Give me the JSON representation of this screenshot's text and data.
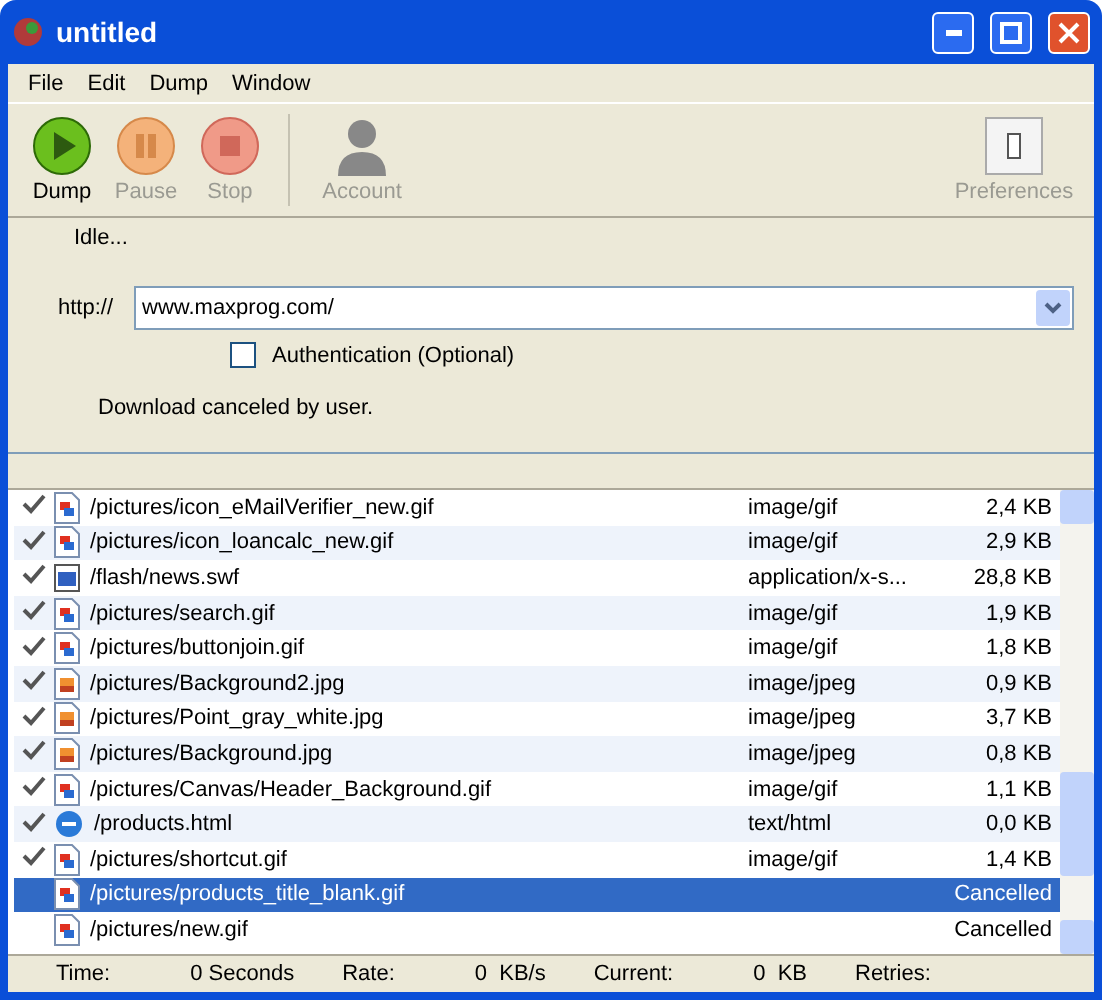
{
  "window": {
    "title": "untitled"
  },
  "menu": [
    "File",
    "Edit",
    "Dump",
    "Window"
  ],
  "toolbar": [
    {
      "label": "Dump",
      "kind": "play",
      "disabled": false
    },
    {
      "label": "Pause",
      "kind": "pause",
      "disabled": true
    },
    {
      "label": "Stop",
      "kind": "stop",
      "disabled": true
    },
    {
      "label": "Account",
      "kind": "account",
      "disabled": true
    },
    {
      "label": "Preferences",
      "kind": "prefs",
      "disabled": true
    }
  ],
  "status": "Idle...",
  "url": {
    "prefix": "http://",
    "value": "www.maxprog.com/"
  },
  "auth": {
    "label": "Authentication (Optional)",
    "checked": false
  },
  "message": "Download canceled by user.",
  "files": [
    {
      "path": "/pictures/icon_eMailVerifier_new.gif",
      "type": "image/gif",
      "size": "2,4 KB",
      "kind": "gif",
      "checked": true,
      "selected": false
    },
    {
      "path": "/pictures/icon_loancalc_new.gif",
      "type": "image/gif",
      "size": "2,9 KB",
      "kind": "gif",
      "checked": true,
      "selected": false
    },
    {
      "path": "/flash/news.swf",
      "type": "application/x-s...",
      "size": "28,8 KB",
      "kind": "swf",
      "checked": true,
      "selected": false
    },
    {
      "path": "/pictures/search.gif",
      "type": "image/gif",
      "size": "1,9 KB",
      "kind": "gif",
      "checked": true,
      "selected": false
    },
    {
      "path": "/pictures/buttonjoin.gif",
      "type": "image/gif",
      "size": "1,8 KB",
      "kind": "gif",
      "checked": true,
      "selected": false
    },
    {
      "path": "/pictures/Background2.jpg",
      "type": "image/jpeg",
      "size": "0,9 KB",
      "kind": "jpg",
      "checked": true,
      "selected": false
    },
    {
      "path": "/pictures/Point_gray_white.jpg",
      "type": "image/jpeg",
      "size": "3,7 KB",
      "kind": "jpg",
      "checked": true,
      "selected": false
    },
    {
      "path": "/pictures/Background.jpg",
      "type": "image/jpeg",
      "size": "0,8 KB",
      "kind": "jpg",
      "checked": true,
      "selected": false
    },
    {
      "path": "/pictures/Canvas/Header_Background.gif",
      "type": "image/gif",
      "size": "1,1 KB",
      "kind": "gif",
      "checked": true,
      "selected": false
    },
    {
      "path": "/products.html",
      "type": "text/html",
      "size": "0,0 KB",
      "kind": "html",
      "checked": true,
      "selected": false
    },
    {
      "path": "/pictures/shortcut.gif",
      "type": "image/gif",
      "size": "1,4 KB",
      "kind": "gif",
      "checked": true,
      "selected": false
    },
    {
      "path": "/pictures/products_title_blank.gif",
      "size": "Cancelled",
      "kind": "gif",
      "checked": false,
      "selected": true
    },
    {
      "path": "/pictures/new.gif",
      "size": "Cancelled",
      "kind": "gif",
      "checked": false,
      "selected": false
    }
  ],
  "status_bar": [
    {
      "label": "Time:",
      "value": "0 Seconds"
    },
    {
      "label": "Rate:",
      "value": "0  KB/s"
    },
    {
      "label": "Current:",
      "value": "0  KB"
    },
    {
      "label": "Retries:"
    }
  ]
}
